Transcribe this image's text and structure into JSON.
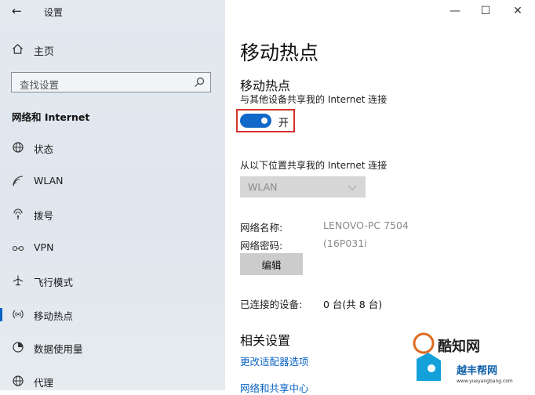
{
  "titlebar": {
    "app_title": "设置",
    "back_icon": "arrow-left-icon",
    "minimize_label": "—",
    "maximize_label": "☐",
    "close_label": "✕"
  },
  "sidebar": {
    "home_label": "主页",
    "search_placeholder": "查找设置",
    "section_title": "网络和 Internet",
    "items": [
      {
        "label": "状态",
        "icon": "globe-icon"
      },
      {
        "label": "WLAN",
        "icon": "wifi-icon"
      },
      {
        "label": "拨号",
        "icon": "dialup-icon"
      },
      {
        "label": "VPN",
        "icon": "vpn-icon"
      },
      {
        "label": "飞行模式",
        "icon": "airplane-icon"
      },
      {
        "label": "移动热点",
        "icon": "hotspot-icon",
        "active": true
      },
      {
        "label": "数据使用量",
        "icon": "data-usage-icon"
      },
      {
        "label": "代理",
        "icon": "globe-icon"
      }
    ]
  },
  "main": {
    "page_title": "移动热点",
    "hotspot_title": "移动热点",
    "share_desc": "与其他设备共享我的 Internet 连接",
    "toggle_state": "开",
    "toggle_on": true,
    "share_from_label": "从以下位置共享我的 Internet 连接",
    "share_from_value": "WLAN",
    "network_name_label": "网络名称:",
    "network_name_value": "LENOVO-PC 7504",
    "network_password_label": "网络密码:",
    "network_password_value": "(16P031i",
    "edit_button": "编辑",
    "connected_devices_label": "已连接的设备:",
    "connected_devices_value": "0 台(共 8 台)",
    "related_title": "相关设置",
    "related_links": [
      "更改适配器选项",
      "网络和共享中心"
    ]
  },
  "watermark": {
    "line1": "酷知网",
    "line2": "越丰帮网",
    "line3": "www.yueyangbang.com"
  },
  "colors": {
    "accent": "#1068c9",
    "highlight_border": "#d5332b",
    "link": "#0b63c4"
  }
}
